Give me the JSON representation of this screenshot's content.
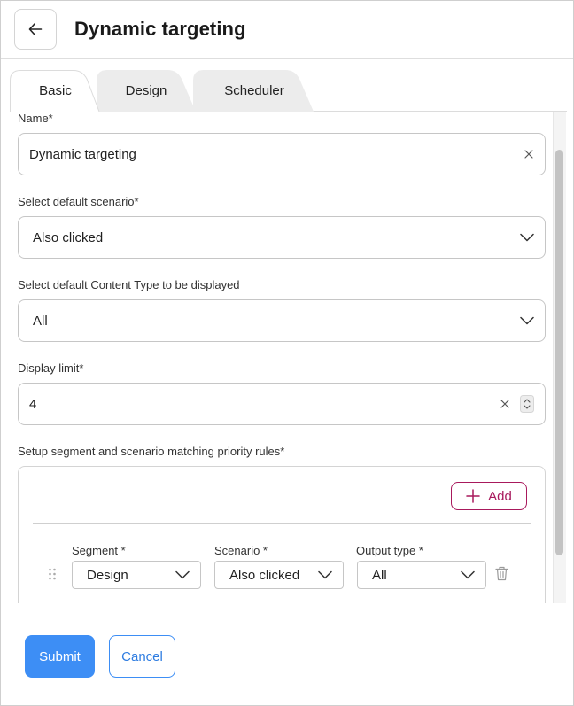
{
  "header": {
    "title": "Dynamic targeting",
    "back_icon": "arrow-left-icon"
  },
  "tabs": [
    {
      "label": "Basic",
      "active": true
    },
    {
      "label": "Design",
      "active": false
    },
    {
      "label": "Scheduler",
      "active": false
    }
  ],
  "form": {
    "name": {
      "label": "Name*",
      "value": "Dynamic targeting"
    },
    "default_scenario": {
      "label": "Select default scenario*",
      "value": "Also clicked"
    },
    "content_type": {
      "label": "Select default Content Type to be displayed",
      "value": "All"
    },
    "display_limit": {
      "label": "Display limit*",
      "value": "4"
    },
    "rules": {
      "label": "Setup segment and scenario matching priority rules*",
      "add_label": "Add",
      "columns": {
        "segment": "Segment *",
        "scenario": "Scenario *",
        "output": "Output type *"
      },
      "rows": [
        {
          "segment": "Design",
          "scenario": "Also clicked",
          "output": "All"
        }
      ]
    }
  },
  "footer": {
    "submit": "Submit",
    "cancel": "Cancel"
  },
  "colors": {
    "primary": "#3d8ef5",
    "add_accent": "#a8195c"
  }
}
